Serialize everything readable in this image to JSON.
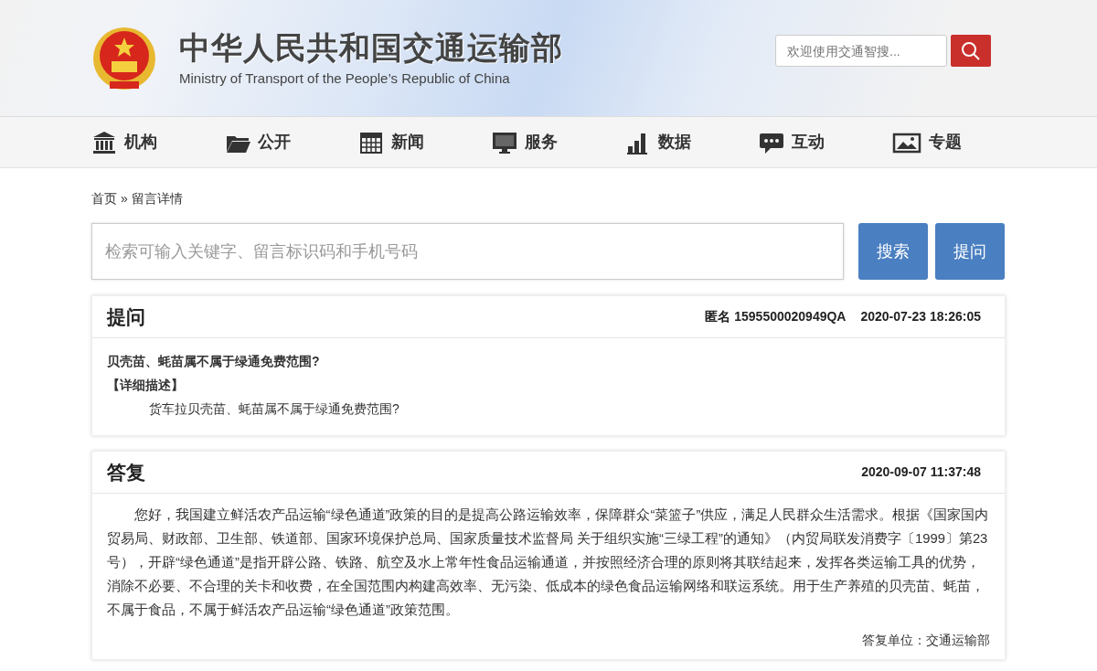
{
  "header": {
    "title": "中华人民共和国交通运输部",
    "subtitle": "Ministry of Transport of the People’s Republic of China",
    "search": {
      "placeholder": "欢迎使用交通智搜..."
    }
  },
  "nav": [
    {
      "label": "机构"
    },
    {
      "label": "公开"
    },
    {
      "label": "新闻"
    },
    {
      "label": "服务"
    },
    {
      "label": "数据"
    },
    {
      "label": "互动"
    },
    {
      "label": "专题"
    }
  ],
  "breadcrumb": {
    "items": [
      "首页",
      "留言详情"
    ],
    "separator": "»"
  },
  "search": {
    "placeholder": "检索可输入关键字、留言标识码和手机号码",
    "buttons": [
      "搜索",
      "提问"
    ]
  },
  "question": {
    "heading": "提问",
    "author": "匿名 1595500020949QA",
    "date": "2020-07-23 18:26:05",
    "title": "贝壳苗、蚝苗属不属于绿通免费范围?",
    "detail_label": "【详细描述】",
    "detail_text": "货车拉贝壳苗、蚝苗属不属于绿通免费范围?"
  },
  "answer": {
    "heading": "答复",
    "date": "2020-09-07 11:37:48",
    "body": "您好，我国建立鲜活农产品运输“绿色通道”政策的目的是提高公路运输效率，保障群众“菜篮子”供应，满足人民群众生活需求。根据《国家国内贸易局、财政部、卫生部、铁道部、国家环境保护总局、国家质量技术监督局 关于组织实施“三绿工程”的通知》（内贸局联发消费字〔1999〕第23号），开辟“绿色通道”是指开辟公路、铁路、航空及水上常年性食品运输通道，并按照经济合理的原则将其联结起来，发挥各类运输工具的优势，消除不必要、不合理的关卡和收费，在全国范围内构建高效率、无污染、低成本的绿色食品运输网络和联运系统。用于生产养殖的贝壳苗、蚝苗，不属于食品，不属于鲜活农产品运输“绿色通道”政策范围。",
    "unit": "答复单位：交通运输部"
  }
}
